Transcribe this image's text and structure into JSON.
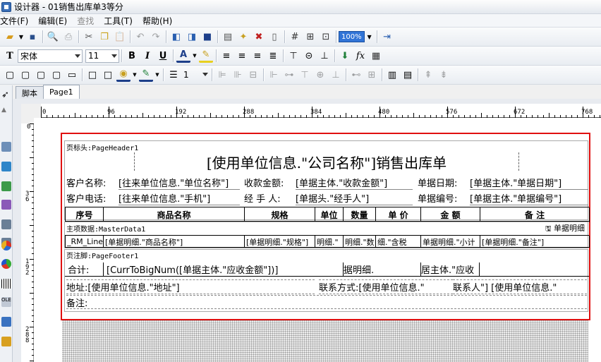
{
  "window": {
    "title": "设计器 - 01销售出库单3等分"
  },
  "menu": [
    "文件(F)",
    "编辑(E)",
    "查找",
    "工具(T)",
    "帮助(H)"
  ],
  "toolbar": {
    "zoom": "100%",
    "font_name": "宋体",
    "font_size": "11",
    "line_width": "1"
  },
  "tabs": [
    "脚本",
    "Page1"
  ],
  "ruler": {
    "top_ticks": [
      "0",
      "96",
      "192",
      "288",
      "384",
      "480",
      "576",
      "672",
      "768"
    ],
    "left_ticks": [
      "0",
      "3 6",
      "1 9 2",
      "2 8 8"
    ]
  },
  "report": {
    "page_header_label": "页标头:PageHeader1",
    "title": "[使用单位信息.\"公司名称\"]销售出库单",
    "customer_name_label": "客户名称:",
    "customer_name_value": "[往来单位信息.\"单位名称\"]",
    "receivable_label": "收款金额:",
    "receivable_value": "[单据主体.\"收款金额\"]",
    "date_label": "单据日期:",
    "date_value": "[单据主体.\"单据日期\"]",
    "customer_phone_label": "客户电话:",
    "customer_phone_value": "[往来单位信息.\"手机\"]",
    "handler_label": "经 手 人:",
    "handler_value": "[单据头.\"经手人\"]",
    "doc_no_label": "单据编号:",
    "doc_no_value": "[单据主体.\"单据编号\"]",
    "columns": [
      "序号",
      "商品名称",
      "规格",
      "单位",
      "数量",
      "单 价",
      "金 额",
      "备 注"
    ],
    "master_label": "主项数据:MasterData1",
    "master_source": "单据明细",
    "detail_cells": [
      "_RM_Line",
      "[单据明细.\"商品名称\"]",
      "[单据明细.\"规格\"]",
      "明细.\"",
      "明细.\"数",
      "细.\"含税",
      "单据明细.\"小计",
      "[单据明细.\"备注\"]"
    ],
    "page_footer_label": "页注脚:PageFooter1",
    "total_label": "合计:",
    "total_value": "[CurrToBigNum([单据主体.\"应收金额\"])]",
    "total_cell2": "据明细.",
    "total_cell3": "居主体.\"应收",
    "address": "地址:[使用单位信息.\"地址\"]",
    "contact_label": "联系方式:[使用单位信息.\"",
    "contact_value": "联系人\"] [使用单位信息.\"",
    "remark_label": "备注:"
  }
}
